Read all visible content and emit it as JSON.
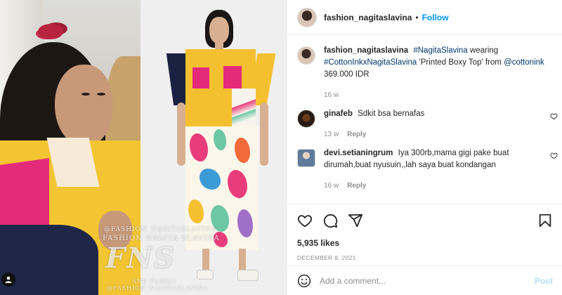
{
  "post": {
    "header": {
      "username": "fashion_nagitaslavina",
      "separator": "•",
      "follow_label": "Follow"
    },
    "caption": {
      "username": "fashion_nagitaslavina",
      "hashtag1": "#NagitaSlavina",
      "word_wearing": "wearing",
      "hashtag2": "#CottonInkxNagitaSlavina",
      "text": "'Printed Boxy Top' from",
      "mention": "@cottonink",
      "price": "369.000 IDR",
      "time": "16 w"
    },
    "comments": [
      {
        "username": "ginafeb",
        "text": "Sdkit bsa bernafas",
        "time": "13 w",
        "reply_label": "Reply"
      },
      {
        "username": "devi.setianingrum",
        "text": "Iya 300rb,mama gigi pake buat dirumah,buat nyusuin,,lah saya buat kondangan",
        "time": "16 w",
        "reply_label": "Reply"
      }
    ],
    "likes": "5,935 likes",
    "date": "DECEMBER 8, 2021",
    "add_comment": {
      "placeholder": "Add a comment...",
      "post_label": "Post"
    }
  },
  "watermark": {
    "handle_top": "@FASHION_NAGITASLAVINA",
    "name": "FASHION NAGITA SLAVINA",
    "logo": "FNS",
    "family": "AND FAMILY",
    "handle_bottom": "@FASHION_NAGITASLAVINA"
  },
  "colors": {
    "follow": "#0095f6",
    "link": "#00376b",
    "muted": "#8e8e8e",
    "post_disabled": "#b2dffc"
  },
  "icons": [
    "heart-icon",
    "comment-icon",
    "share-icon",
    "bookmark-icon",
    "emoji-icon",
    "user-tag-icon"
  ]
}
